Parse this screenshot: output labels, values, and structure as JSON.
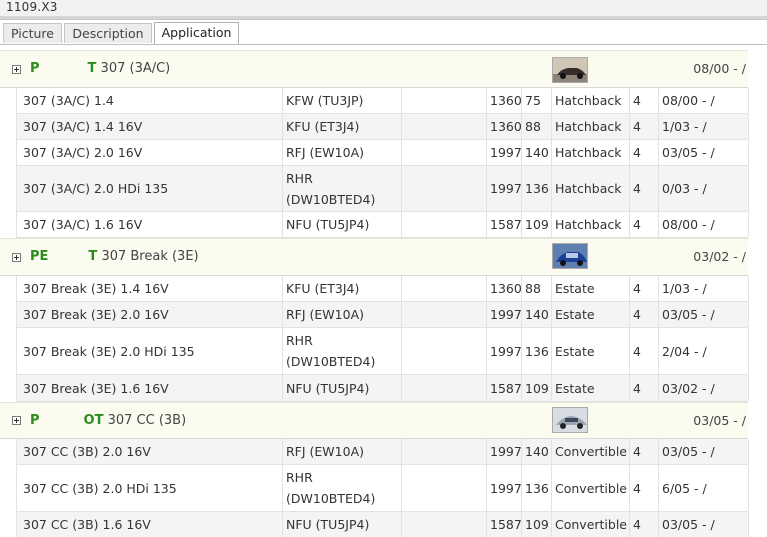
{
  "window": {
    "title": "1109.X3"
  },
  "tabs": [
    {
      "label": "Picture"
    },
    {
      "label": "Description"
    },
    {
      "label": "Application"
    }
  ],
  "groups": [
    {
      "brand_prefix": "P",
      "brand_suffix": "T",
      "model": "307 (3A/C)",
      "date": "08/00 - /",
      "rows": [
        {
          "name": "307 (3A/C) 1.4",
          "engine": "KFW (TU3JP)",
          "extra": "",
          "cc": "1360",
          "kw": "75",
          "body": "Hatchback",
          "doors": "4",
          "date": "08/00 - /"
        },
        {
          "name": "307 (3A/C) 1.4 16V",
          "engine": "KFU (ET3J4)",
          "extra": "",
          "cc": "1360",
          "kw": "88",
          "body": "Hatchback",
          "doors": "4",
          "date": "1/03 - /"
        },
        {
          "name": "307 (3A/C) 2.0 16V",
          "engine": "RFJ (EW10A)",
          "extra": "",
          "cc": "1997",
          "kw": "140",
          "body": "Hatchback",
          "doors": "4",
          "date": "03/05 - /"
        },
        {
          "name": "307 (3A/C) 2.0 HDi 135",
          "engine": "RHR (DW10BTED4)",
          "extra": "",
          "cc": "1997",
          "kw": "136",
          "body": "Hatchback",
          "doors": "4",
          "date": "0/03 - /"
        },
        {
          "name": "307 (3A/C) 1.6 16V",
          "engine": "NFU (TU5JP4)",
          "extra": "",
          "cc": "1587",
          "kw": "109",
          "body": "Hatchback",
          "doors": "4",
          "date": "08/00 - /"
        }
      ]
    },
    {
      "brand_prefix": "PE",
      "brand_suffix": "T",
      "model": "307 Break (3E)",
      "date": "03/02 - /",
      "rows": [
        {
          "name": "307 Break (3E) 1.4 16V",
          "engine": "KFU (ET3J4)",
          "extra": "",
          "cc": "1360",
          "kw": "88",
          "body": "Estate",
          "doors": "4",
          "date": "1/03 - /"
        },
        {
          "name": "307 Break (3E) 2.0 16V",
          "engine": "RFJ (EW10A)",
          "extra": "",
          "cc": "1997",
          "kw": "140",
          "body": "Estate",
          "doors": "4",
          "date": "03/05 - /"
        },
        {
          "name": "307 Break (3E) 2.0 HDi 135",
          "engine": "RHR (DW10BTED4)",
          "extra": "",
          "cc": "1997",
          "kw": "136",
          "body": "Estate",
          "doors": "4",
          "date": "2/04 - /"
        },
        {
          "name": "307 Break (3E) 1.6 16V",
          "engine": "NFU (TU5JP4)",
          "extra": "",
          "cc": "1587",
          "kw": "109",
          "body": "Estate",
          "doors": "4",
          "date": "03/02 - /"
        }
      ]
    },
    {
      "brand_prefix": "P",
      "brand_suffix": "OT",
      "model": "307 CC (3B)",
      "date": "03/05 - /",
      "rows": [
        {
          "name": "307 CC (3B) 2.0 16V",
          "engine": "RFJ (EW10A)",
          "extra": "",
          "cc": "1997",
          "kw": "140",
          "body": "Convertible",
          "doors": "4",
          "date": "03/05 - /"
        },
        {
          "name": "307 CC (3B) 2.0 HDi 135",
          "engine": "RHR (DW10BTED4)",
          "extra": "",
          "cc": "1997",
          "kw": "136",
          "body": "Convertible",
          "doors": "4",
          "date": "6/05 - /"
        },
        {
          "name": "307 CC (3B) 1.6 16V",
          "engine": "NFU (TU5JP4)",
          "extra": "",
          "cc": "1587",
          "kw": "109",
          "body": "Convertible",
          "doors": "4",
          "date": "03/05 - /"
        }
      ]
    }
  ],
  "colors": {
    "brand_green": "#2e8b1e",
    "group_header_bg": "#fbfbf0",
    "row_alt_bg": "#f4f4f4",
    "grid_line": "#e2e2e2"
  },
  "icons": [
    "expand-plus-icon",
    "car-thumbnail-icon"
  ]
}
